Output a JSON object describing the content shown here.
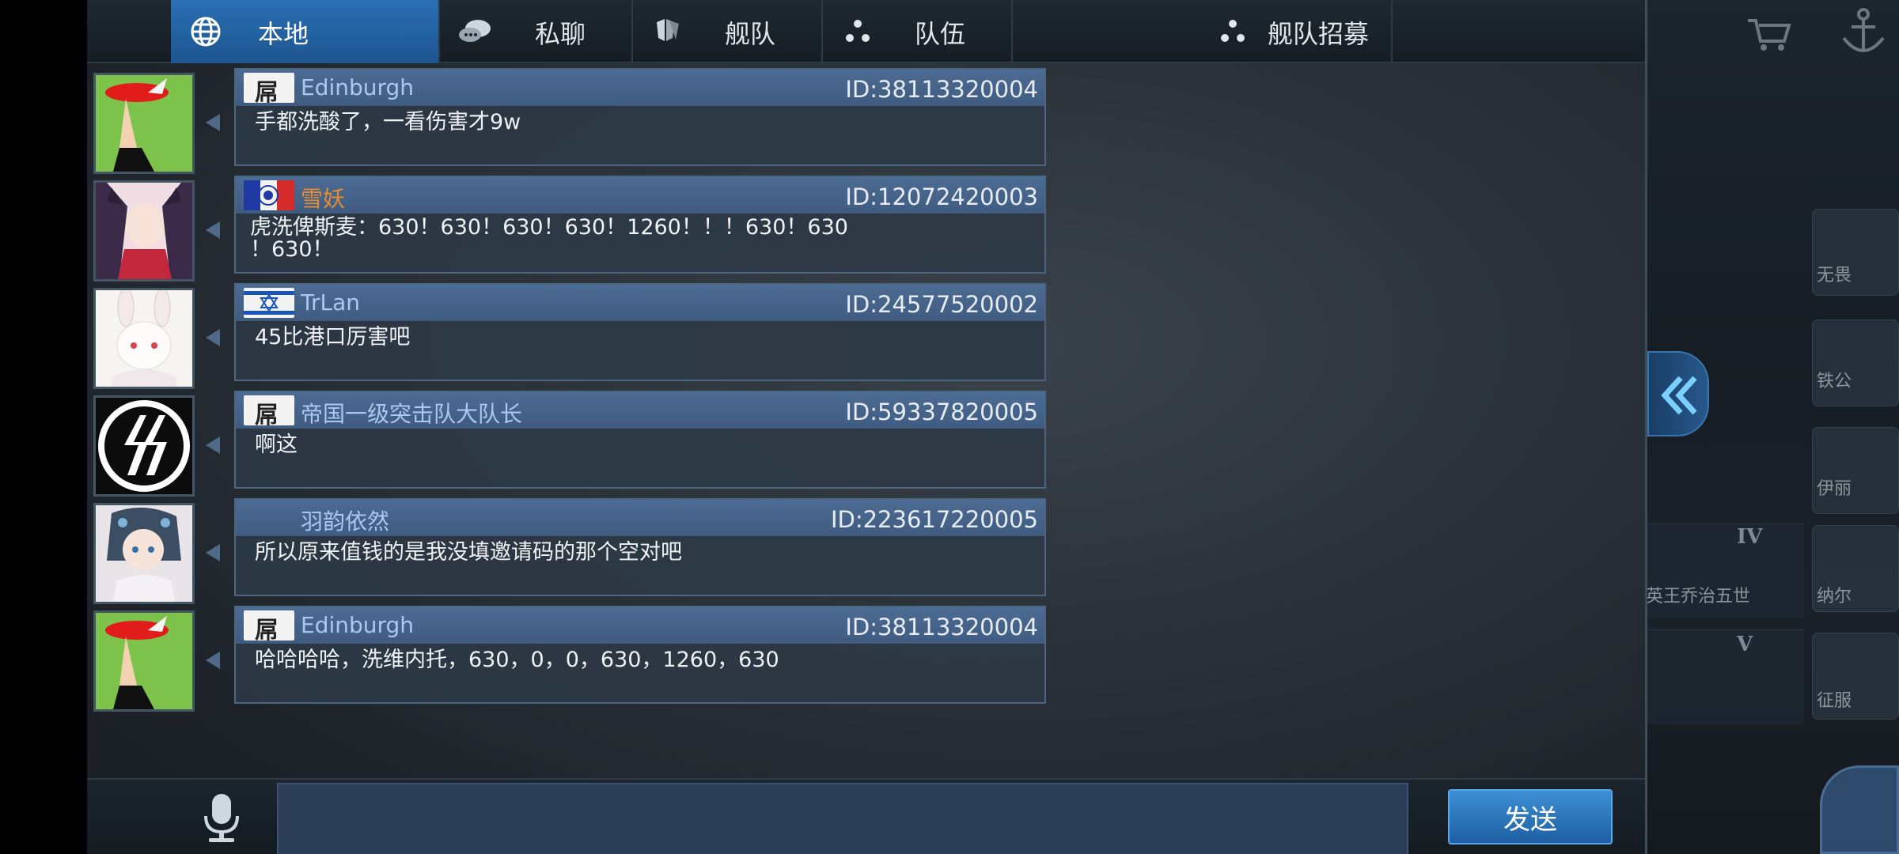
{
  "tabs": [
    {
      "label": "本地",
      "icon": "globe-icon",
      "active": true
    },
    {
      "label": "私聊",
      "icon": "chat-bubbles-icon",
      "active": false
    },
    {
      "label": "舰队",
      "icon": "fleet-shield-icon",
      "active": false
    },
    {
      "label": "队伍",
      "icon": "team-dots-icon",
      "active": false
    },
    {
      "label": "舰队招募",
      "icon": "team-dots-icon",
      "active": false
    }
  ],
  "messages": [
    {
      "name": "Edinburgh",
      "id": "ID:38113320004",
      "text": "手都洗酸了，一看伤害才9w",
      "flag": "white-flag-icon",
      "avatar": "beret-character-avatar"
    },
    {
      "name": "雪妖",
      "id": "ID:12072420003",
      "text": "虎洗俾斯麦：630！630！630！630！1260！！！630！630\n！630！",
      "flag": "french-flag-icon",
      "avatar": "anime-fox-girl-avatar",
      "name_color": "orange"
    },
    {
      "name": "TrLan",
      "id": "ID:24577520002",
      "text": "45比港口厉害吧",
      "flag": "israel-flag-icon",
      "avatar": "bunny-girl-avatar"
    },
    {
      "name": "帝国一级突击队大队长",
      "id": "ID:59337820005",
      "text": "啊这",
      "flag": "white-flag-icon",
      "avatar": "ss-runes-avatar"
    },
    {
      "name": "羽韵依然",
      "id": "ID:223617220005",
      "text": "所以原来值钱的是我没填邀请码的那个空对吧",
      "flag": "",
      "avatar": "anime-girl-avatar"
    },
    {
      "name": "Edinburgh",
      "id": "ID:38113320004",
      "text": "哈哈哈哈，洗维内托，630，0，0，630，1260，630",
      "flag": "white-flag-icon",
      "avatar": "beret-character-avatar"
    }
  ],
  "flag_text": "屌",
  "input": {
    "placeholder": "",
    "value": ""
  },
  "send_label": "发送",
  "game_side": {
    "labels": [
      "无畏",
      "铁公",
      "伊丽",
      "纳尔",
      "征服"
    ],
    "list_text": "英王乔治五世",
    "tiers": [
      "IV",
      "V"
    ]
  },
  "colors": {
    "accent": "#2a6fb4",
    "name_blue": "#a9c9f0",
    "name_orange": "#e58d34"
  }
}
